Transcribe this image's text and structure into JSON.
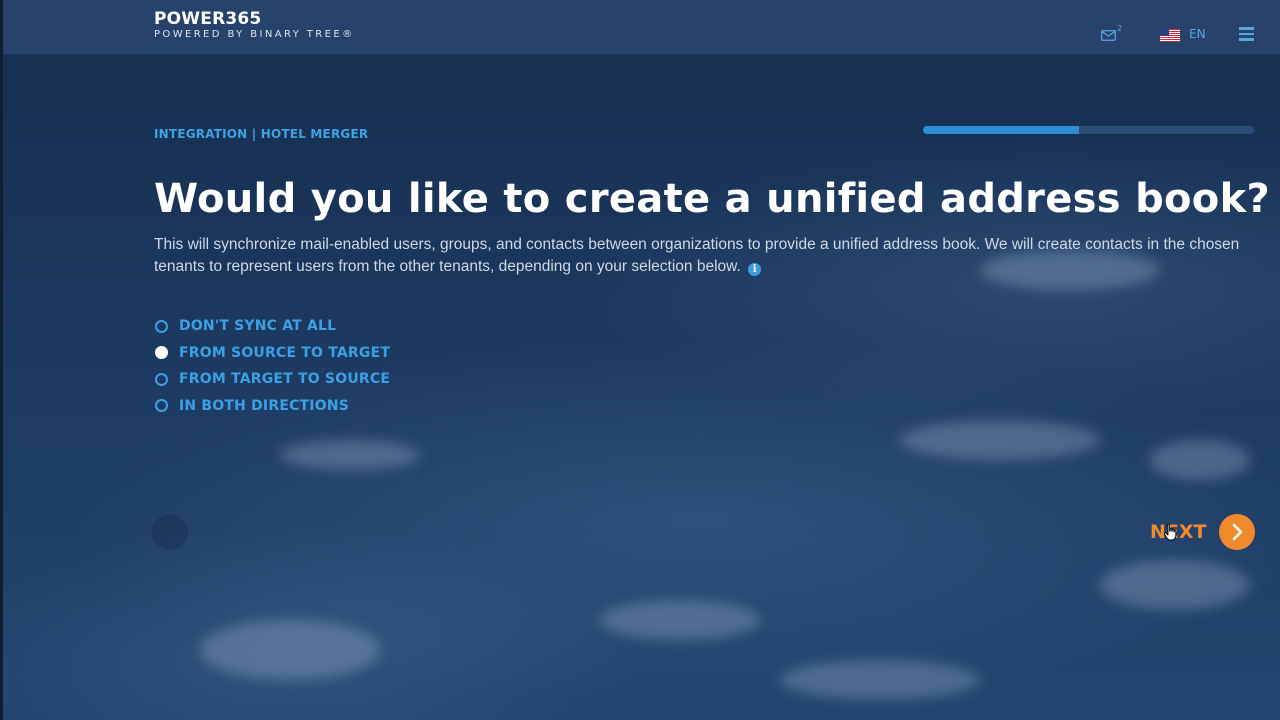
{
  "header": {
    "logo_title": "POWER365",
    "logo_subtitle": "POWERED BY BINARY TREE®",
    "mail_badge": "2",
    "language": "EN"
  },
  "breadcrumb": "INTEGRATION | HOTEL MERGER",
  "progress": {
    "fraction": 0.47
  },
  "title": "Would you like to create a unified address book?",
  "description": "This will synchronize mail-enabled users, groups, and contacts between organizations to provide a unified address book. We will create contacts in the chosen tenants to represent users from the other tenants, depending on your selection below.",
  "options": [
    {
      "label": "DON'T SYNC AT ALL",
      "selected": false
    },
    {
      "label": "FROM SOURCE TO TARGET",
      "selected": true
    },
    {
      "label": "FROM TARGET TO SOURCE",
      "selected": false
    },
    {
      "label": "IN BOTH DIRECTIONS",
      "selected": false
    }
  ],
  "next_label": "NEXT",
  "colors": {
    "accent": "#3ba1e4",
    "next": "#f08a2a",
    "header_bg": "#27436b"
  }
}
